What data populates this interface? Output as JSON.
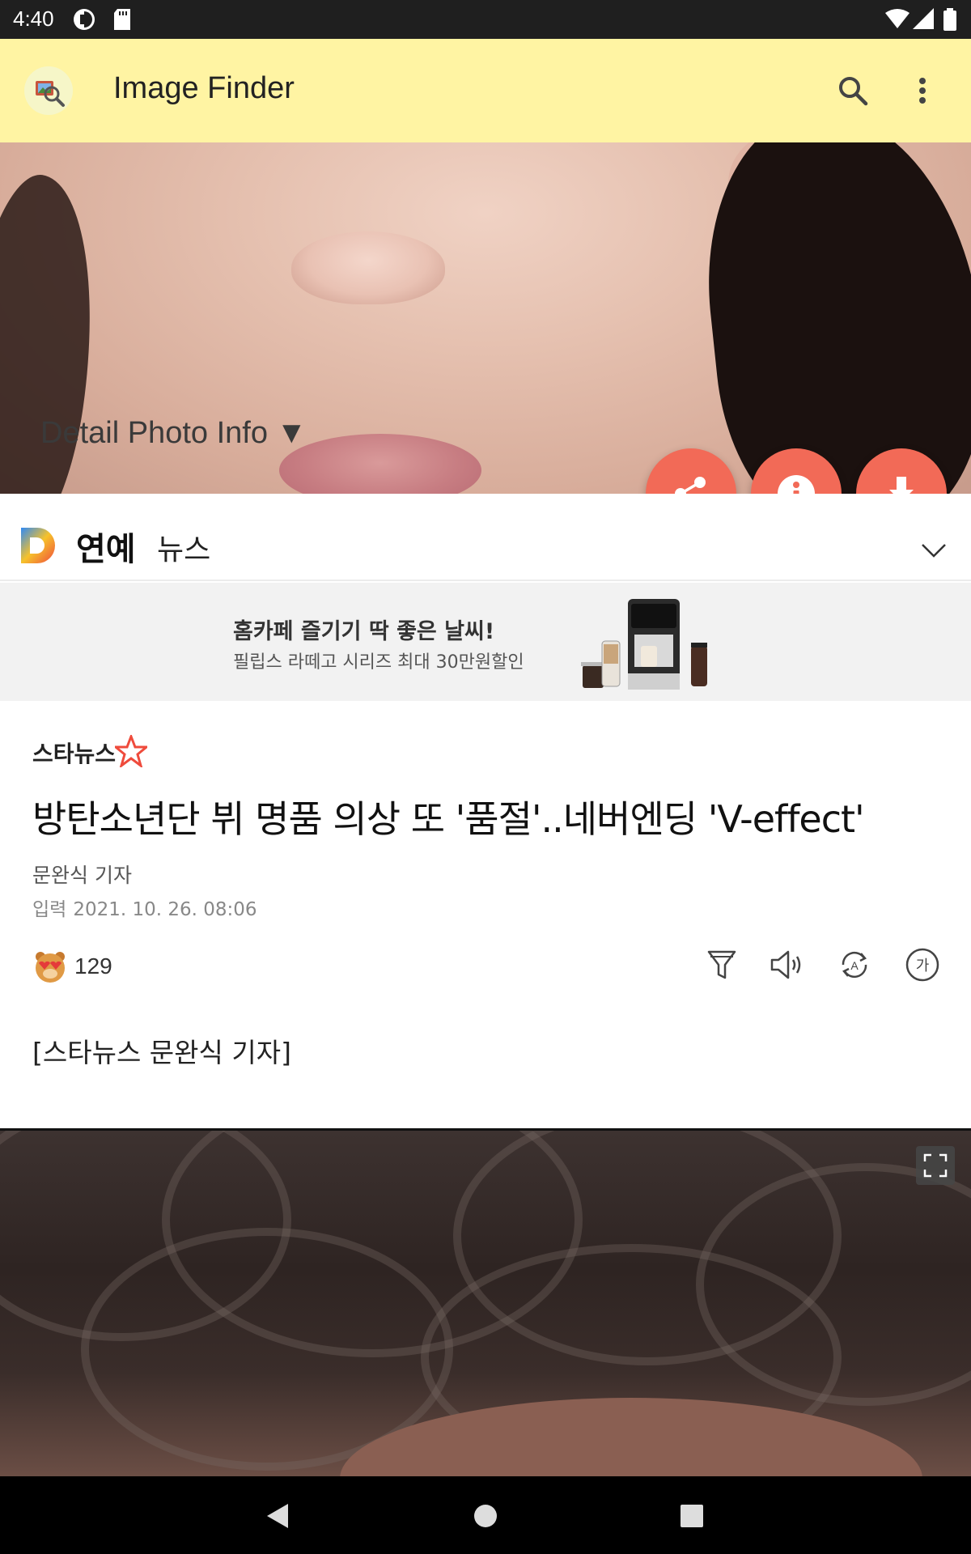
{
  "status_bar": {
    "time": "4:40"
  },
  "app_bar": {
    "title": "Image Finder"
  },
  "hero": {
    "caption": "Detail Photo Info ▼"
  },
  "daum": {
    "section": "연예",
    "category": "뉴스"
  },
  "ad": {
    "title": "홈카페 즐기기 딱 좋은 날씨!",
    "subtitle": "필립스 라떼고 시리즈 최대 30만원할인"
  },
  "article": {
    "press": "스타뉴스",
    "headline": "방탄소년단 뷔 명품 의상 또 '품절'..네버엔딩 'V-effect'",
    "reporter": "문완식 기자",
    "date_label": "입력",
    "date": "2021. 10. 26. 08:06",
    "reaction_count": "129",
    "body": "[스타뉴스 문완식 기자]"
  },
  "tools": {
    "text_size_label": "가"
  },
  "colors": {
    "app_bar": "#fff4a3",
    "fab": "#f26a57"
  }
}
